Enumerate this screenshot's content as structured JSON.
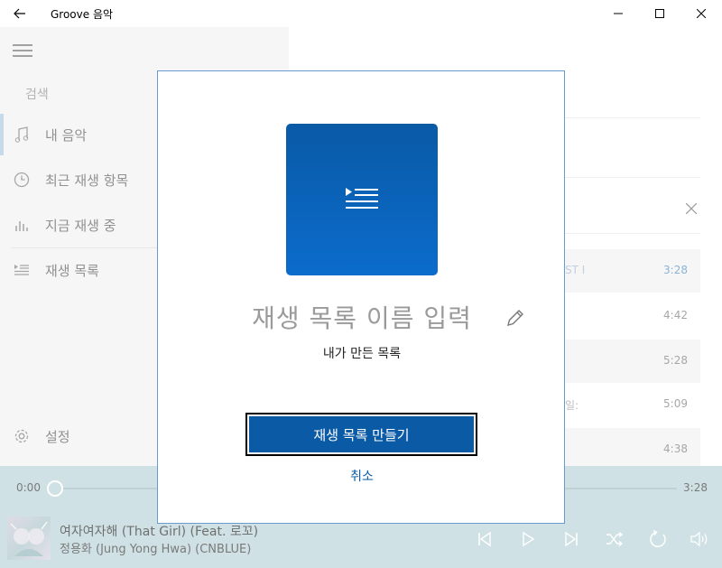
{
  "window": {
    "title": "Groove 음악"
  },
  "sidebar": {
    "search_placeholder": "검색",
    "items": [
      {
        "label": "내 음악",
        "icon": "music-note-icon",
        "active": true
      },
      {
        "label": "최근 재생 항목",
        "icon": "clock-icon"
      },
      {
        "label": "지금 재생 중",
        "icon": "equalizer-icon"
      },
      {
        "label": "재생 목록",
        "icon": "playlist-icon"
      }
    ],
    "settings_label": "설정"
  },
  "main": {
    "rows": [
      {
        "duration": "3:28",
        "peek": "ST I"
      },
      {
        "duration": "4:42"
      },
      {
        "duration": "5:28"
      },
      {
        "duration": "5:09",
        "peek": "일: "
      },
      {
        "duration": "4:38"
      }
    ]
  },
  "dialog": {
    "name_placeholder": "재생 목록 이름 입력",
    "subtitle": "내가 만든 목록",
    "create_label": "재생 목록 만들기",
    "cancel_label": "취소"
  },
  "player": {
    "current_time": "0:00",
    "total_time": "3:28",
    "progress": 0.0,
    "song_title": "여자여자해 (That Girl) (Feat. 로꼬)",
    "artist": "정용화 (Jung Yong Hwa) (CNBLUE)"
  },
  "colors": {
    "accent": "#0a5aa6",
    "player_bg": "#b5d1d6",
    "sidebar_bg": "#f2f2f2"
  }
}
